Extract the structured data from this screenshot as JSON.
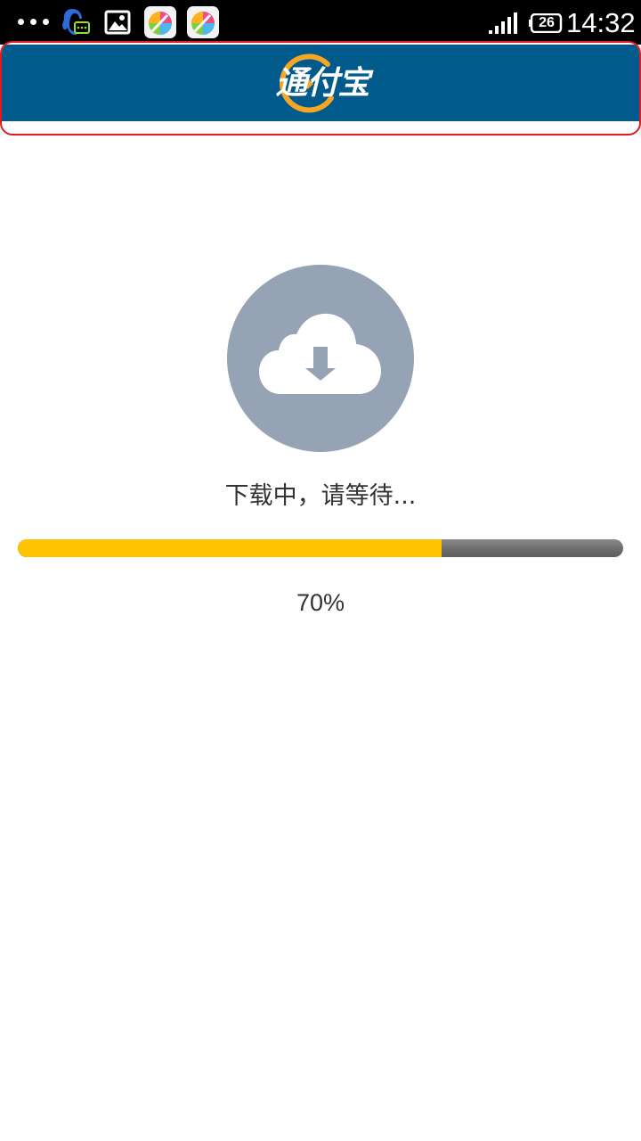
{
  "status_bar": {
    "notifications": [
      "more-dots-icon",
      "qq-message-icon",
      "gallery-icon",
      "app-store-icon",
      "app-store-icon"
    ],
    "battery": "26",
    "time": "14:32",
    "signal_icon": "signal-bars-icon"
  },
  "header": {
    "logo_text": "通付宝",
    "background_color": "#005a8c",
    "accent_color": "#f5a623"
  },
  "download": {
    "icon": "cloud-download-icon",
    "status_text": "下载中，请等待...",
    "progress": 0.7,
    "progress_label": "70%",
    "fill_color": "#fec301",
    "track_color": "#6f6f6f"
  }
}
